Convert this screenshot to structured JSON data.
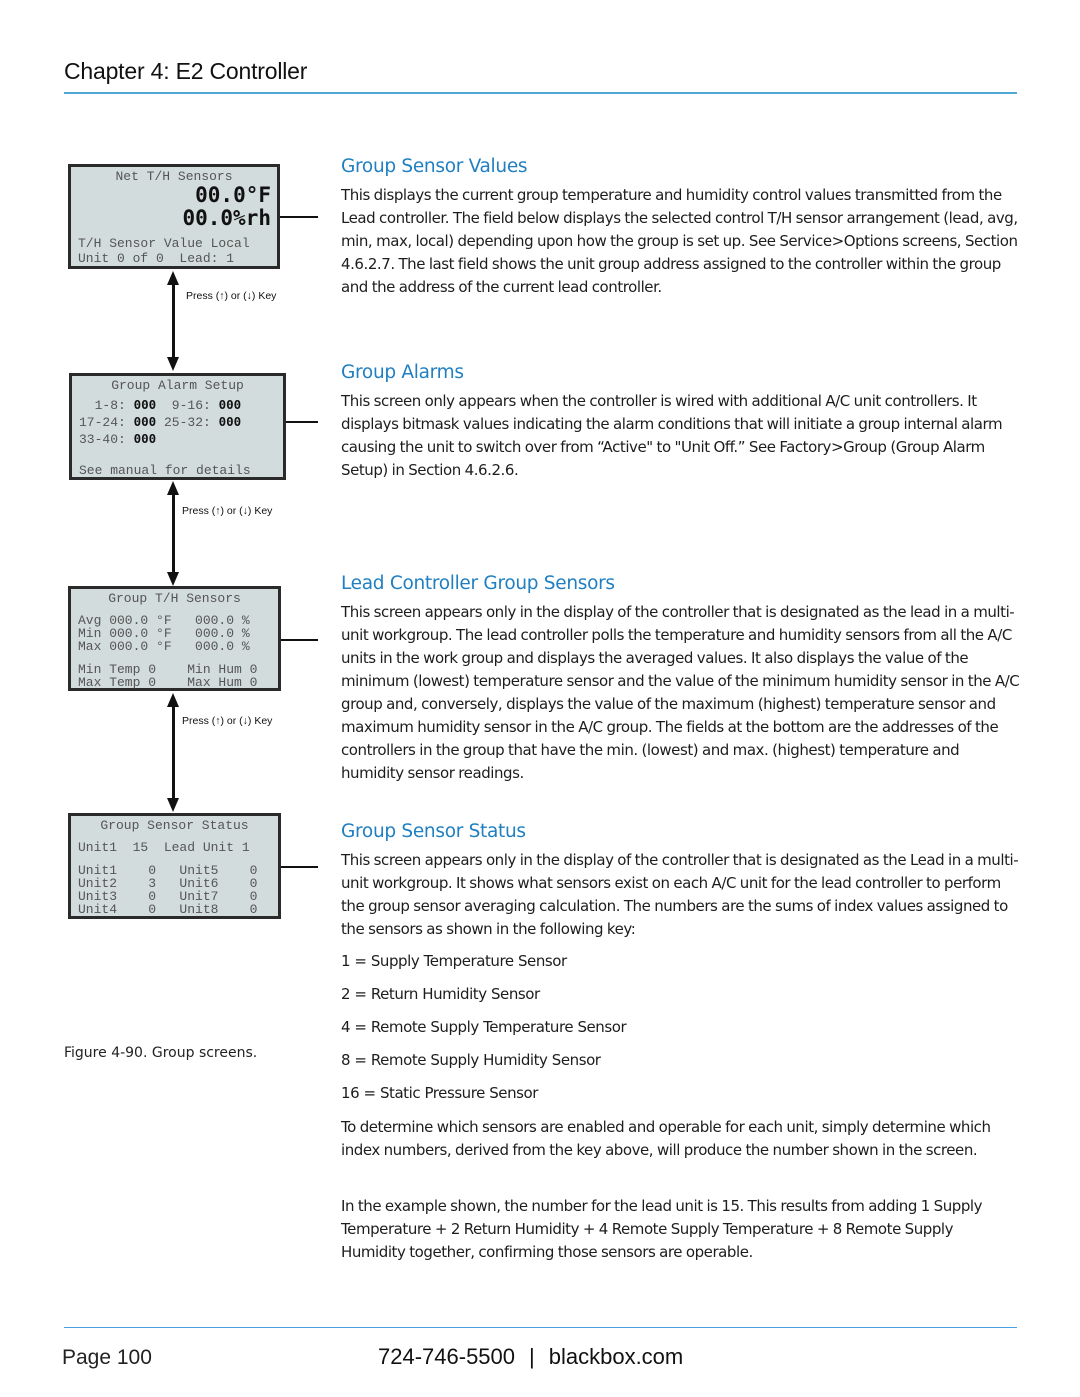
{
  "header": {
    "chapter_title": "Chapter 4: E2 Controller"
  },
  "colors": {
    "accent": "#1f7fc0",
    "rule": "#4fa8d6",
    "lcd_background": "#d2dcdc"
  },
  "figure": {
    "caption": "Figure 4-90. Group screens.",
    "press_label": "Press (↑) or (↓) Key",
    "screens": {
      "net_th": {
        "title": "Net T/H Sensors",
        "temp": "00.0°F",
        "humidity": "00.0%rh",
        "line3": "T/H Sensor Value Local",
        "line4": "Unit 0 of 0  Lead: 1"
      },
      "alarm_setup": {
        "title": "Group Alarm Setup",
        "rows": [
          {
            "l1": "  1-8: ",
            "v1": "000",
            "l2": "  9-16: ",
            "v2": "000"
          },
          {
            "l1": "17-24: ",
            "v1": "000",
            "l2": " 25-32: ",
            "v2": "000"
          },
          {
            "l1": "33-40: ",
            "v1": "000",
            "l2": "",
            "v2": ""
          }
        ],
        "footer": "See manual for details"
      },
      "group_th": {
        "title": "Group T/H Sensors",
        "rows": [
          "Avg 000.0 °F   000.0 %",
          "Min 000.0 °F   000.0 %",
          "Max 000.0 °F   000.0 %"
        ],
        "addr_rows": [
          "Min Temp 0    Min Hum 0",
          "Max Temp 0    Max Hum 0"
        ]
      },
      "sensor_status": {
        "title": "Group Sensor Status",
        "lead_line": "Unit1  15  Lead Unit 1",
        "units": [
          "Unit1    0   Unit5    0",
          "Unit2    3   Unit6    0",
          "Unit3    0   Unit7    0",
          "Unit4    0   Unit8    0"
        ]
      }
    }
  },
  "sections": {
    "group_sensor_values": {
      "heading": "Group Sensor Values",
      "body": "This displays the current group temperature and humidity control values transmitted from the Lead controller. The field below displays the selected control T/H sensor arrangement (lead, avg, min, max, local) depending upon how the group is set up. See Service>Options screens, Section 4.6.2.7. The last field shows the unit group address assigned to the controller within the group and the address of the current lead controller."
    },
    "group_alarms": {
      "heading": "Group Alarms",
      "body": "This screen only appears when the controller is wired with additional A/C unit controllers. It displays bitmask values indicating the alarm conditions that will initiate a group internal alarm causing the unit to switch over from “Active\" to \"Unit Off.” See Factory>Group (Group Alarm Setup) in Section 4.6.2.6."
    },
    "lead_controller_group_sensors": {
      "heading": "Lead Controller Group Sensors",
      "body": "This screen appears only in the display of the controller that is designated as the lead in a multi-unit workgroup. The lead controller polls the temperature and humidity sensors from all the A/C units in the work group and displays the averaged values. It also displays the value of the minimum (lowest) temperature sensor and the value of the minimum humidity sensor in the A/C group and, conversely, displays the value of the maximum (highest) temperature sensor and maximum humidity sensor in the A/C group. The fields at the bottom are the addresses of the controllers in the group that have the min. (lowest) and max. (highest) temperature and humidity sensor readings."
    },
    "group_sensor_status": {
      "heading": "Group Sensor Status",
      "body": "This screen appears only in the display of the controller that is designated as the Lead in a multi-unit workgroup. It shows what sensors exist on each A/C unit for the lead controller to perform the group sensor averaging calculation. The numbers are the sums of index values assigned to the sensors as shown in the following key:",
      "key": [
        "1 = Supply Temperature Sensor",
        "2 = Return Humidity Sensor",
        "4 = Remote Supply Temperature Sensor",
        "8 = Remote Supply Humidity Sensor",
        "16 = Static Pressure Sensor"
      ],
      "para2": "To determine which sensors are enabled and operable for each unit, simply determine which index numbers, derived from the key above, will produce the number shown in the screen.",
      "para3": "In the example shown, the number for the lead unit is 15. This results from adding 1 Supply Temperature + 2 Return Humidity + 4 Remote Supply Temperature + 8 Remote Supply Humidity together, confirming those sensors are operable."
    }
  },
  "footer": {
    "page": "Page 100",
    "phone": "724-746-5500",
    "separator": "|",
    "website": "blackbox.com"
  }
}
